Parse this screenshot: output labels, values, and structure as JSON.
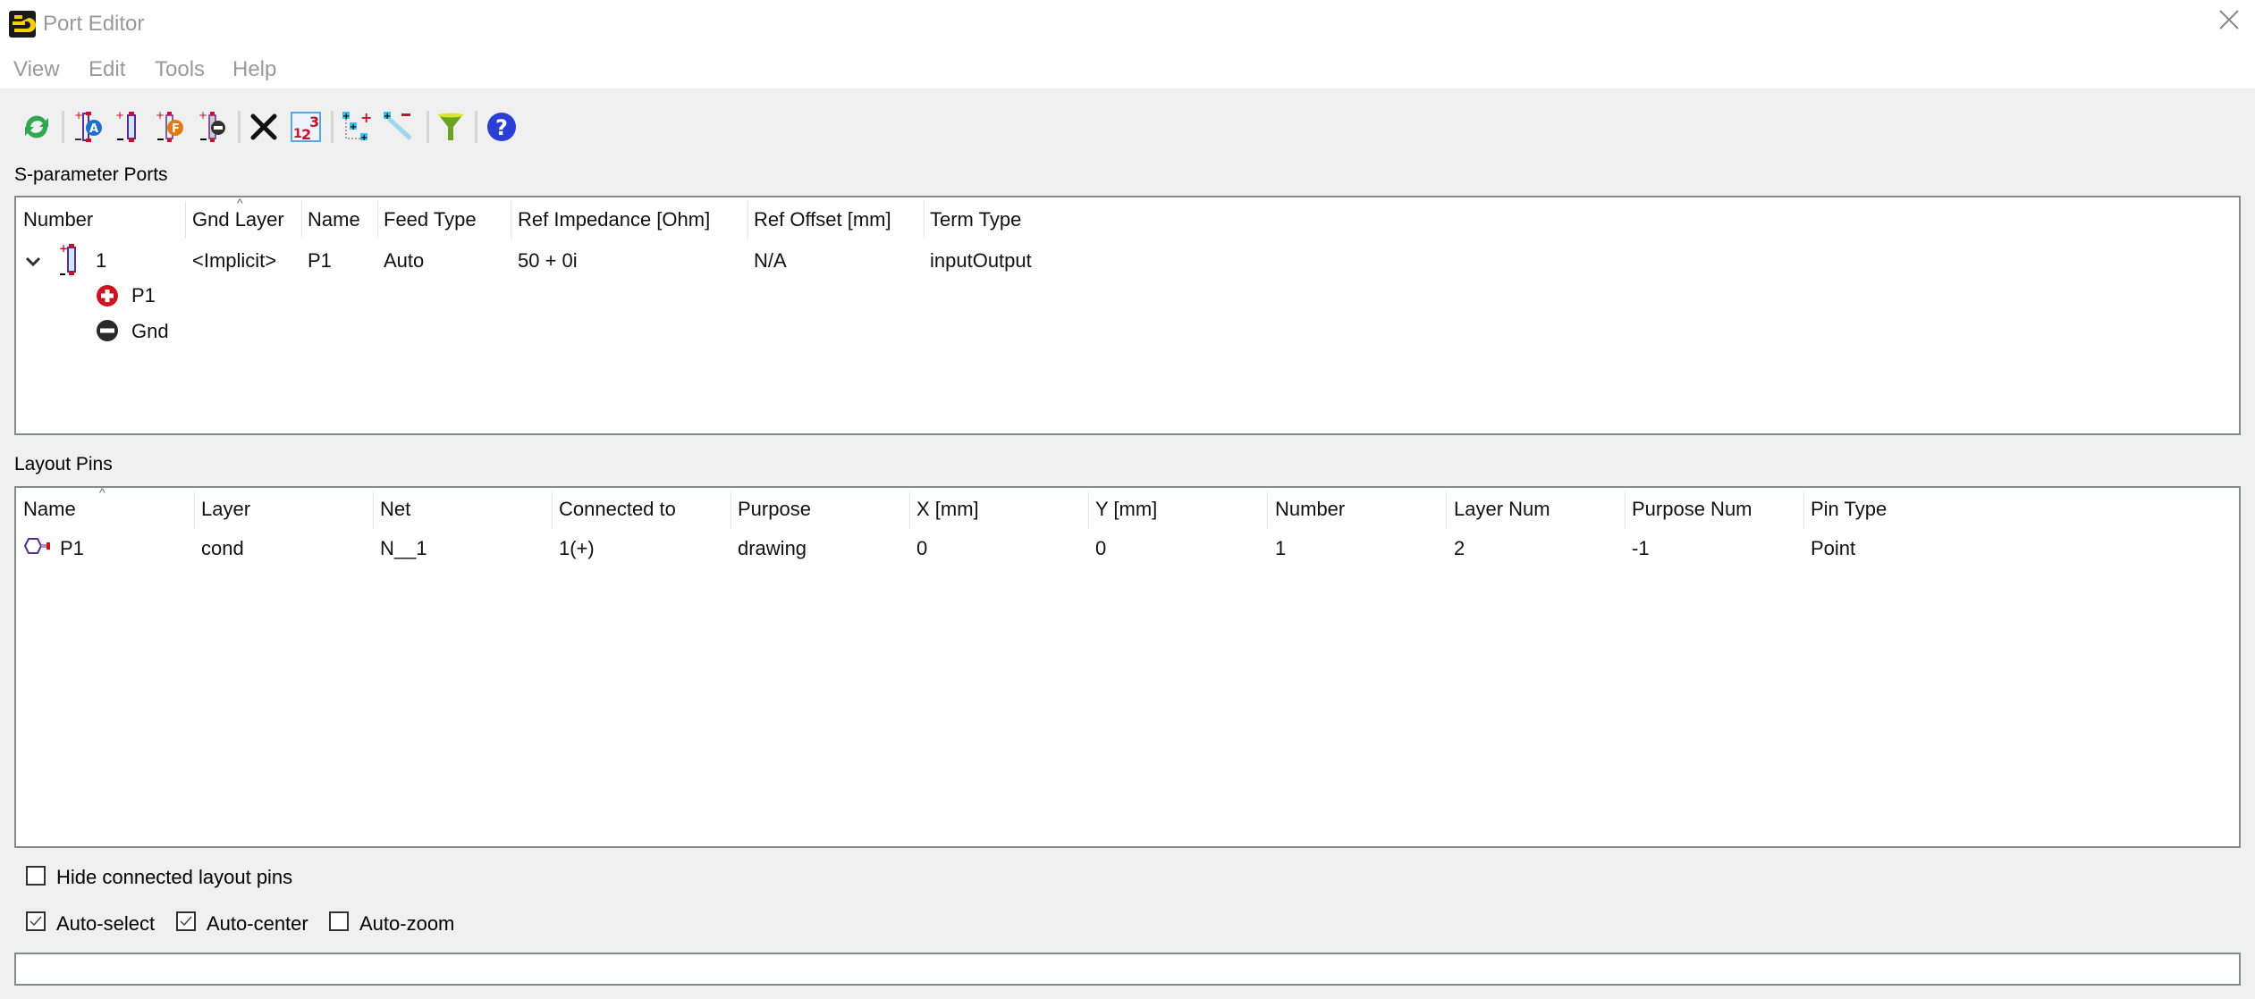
{
  "window": {
    "title": "Port Editor",
    "icons": {
      "app": "app-logo-icon",
      "close": "close-icon"
    }
  },
  "menu": {
    "items": [
      "View",
      "Edit",
      "Tools",
      "Help"
    ]
  },
  "toolbar": {
    "buttons": [
      {
        "icon": "refresh-icon",
        "tooltip": "Refresh"
      },
      {
        "icon": "add-auto-port-icon",
        "tooltip": "Add auto port"
      },
      {
        "icon": "add-port-icon",
        "tooltip": "Add port"
      },
      {
        "icon": "add-feed-port-icon",
        "tooltip": "Add feed port"
      },
      {
        "icon": "add-ground-port-icon",
        "tooltip": "Add ground port"
      },
      {
        "icon": "delete-icon",
        "tooltip": "Delete"
      },
      {
        "icon": "renumber-icon",
        "tooltip": "Renumber"
      },
      {
        "icon": "add-pins-icon",
        "tooltip": "Add pins"
      },
      {
        "icon": "remove-pins-icon",
        "tooltip": "Remove pins"
      },
      {
        "icon": "filter-icon",
        "tooltip": "Filter"
      },
      {
        "icon": "help-icon",
        "tooltip": "Help"
      }
    ]
  },
  "sparam": {
    "label": "S-parameter Ports",
    "columns": [
      "Number",
      "Gnd Layer",
      "Name",
      "Feed Type",
      "Ref Impedance [Ohm]",
      "Ref Offset [mm]",
      "Term Type"
    ],
    "sorted_column": "Gnd Layer",
    "rows": [
      {
        "number": "1",
        "gnd_layer": "<Implicit>",
        "name": "P1",
        "feed_type": "Auto",
        "ref_impedance": "50 + 0i",
        "ref_offset": "N/A",
        "term_type": "inputOutput",
        "expanded": true,
        "children": [
          {
            "icon": "plus-terminal-icon",
            "label": "P1"
          },
          {
            "icon": "minus-terminal-icon",
            "label": "Gnd"
          }
        ]
      }
    ]
  },
  "pins": {
    "label": "Layout Pins",
    "columns": [
      "Name",
      "Layer",
      "Net",
      "Connected to",
      "Purpose",
      "X [mm]",
      "Y [mm]",
      "Number",
      "Layer Num",
      "Purpose Num",
      "Pin Type"
    ],
    "sorted_column": "Name",
    "rows": [
      {
        "cells": [
          "P1",
          "cond",
          "N__1",
          "1(+)",
          "drawing",
          "0",
          "0",
          "1",
          "2",
          "-1",
          "Point"
        ]
      }
    ]
  },
  "options": {
    "hide_connected": {
      "label": "Hide connected layout pins",
      "checked": false
    },
    "auto_select": {
      "label": "Auto-select",
      "checked": true
    },
    "auto_center": {
      "label": "Auto-center",
      "checked": true
    },
    "auto_zoom": {
      "label": "Auto-zoom",
      "checked": false
    }
  },
  "status": {
    "text": ""
  }
}
